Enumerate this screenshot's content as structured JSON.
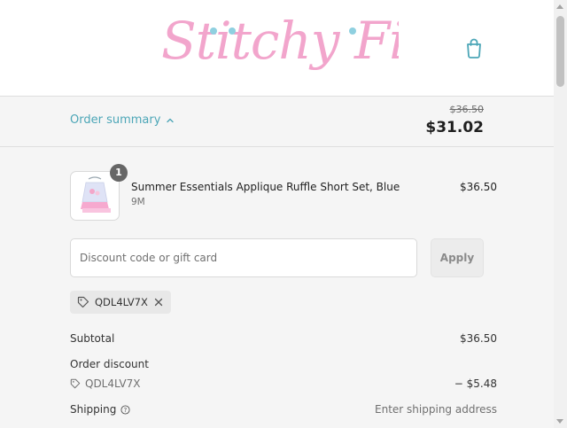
{
  "brand": {
    "logo_text": "Stitchy Fish",
    "logo_color": "#f2a5cc",
    "dot_color": "#8fd0e0"
  },
  "header": {
    "cart_icon": "shopping-bag-icon"
  },
  "summary": {
    "toggle_label": "Order summary",
    "toggle_icon": "chevron-up-icon",
    "original_total": "$36.50",
    "total": "$31.02"
  },
  "line_items": [
    {
      "quantity": "1",
      "name": "Summer Essentials Applique Ruffle Short Set, Blue",
      "variant": "9M",
      "price": "$36.50"
    }
  ],
  "discount": {
    "placeholder": "Discount code or gift card",
    "value": "",
    "apply_label": "Apply",
    "applied_code": "QDL4LV7X",
    "remove_icon": "close-icon"
  },
  "totals": {
    "subtotal_label": "Subtotal",
    "subtotal_value": "$36.50",
    "order_discount_label": "Order discount",
    "order_discount_code": "QDL4LV7X",
    "order_discount_value": "− $5.48",
    "shipping_label": "Shipping",
    "shipping_value": "Enter shipping address"
  },
  "colors": {
    "accent": "#4ca6b7",
    "total_text": "#1f1f1f",
    "muted": "#707070"
  }
}
